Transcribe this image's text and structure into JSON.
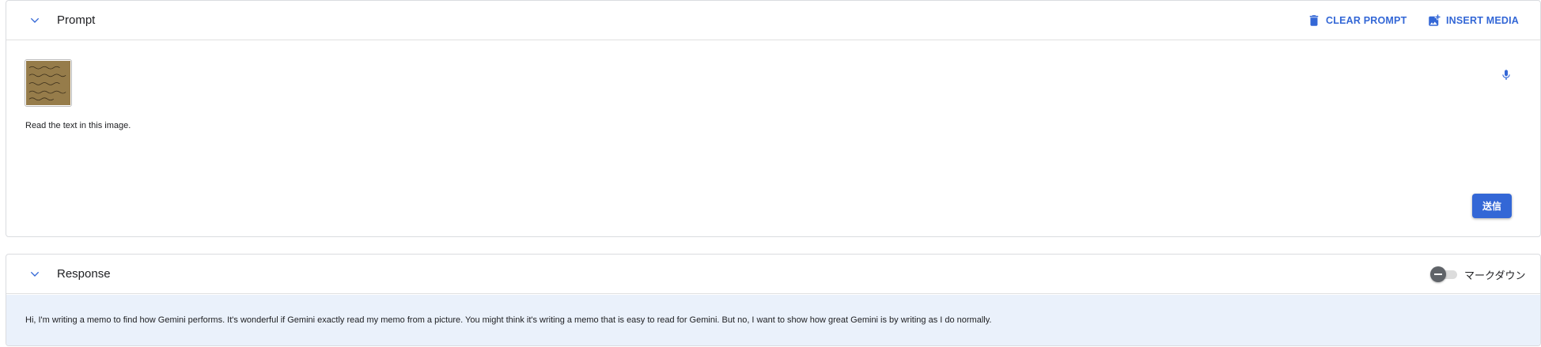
{
  "prompt": {
    "title": "Prompt",
    "clear_label": "CLEAR PROMPT",
    "insert_label": "INSERT MEDIA",
    "text": "Read the text in this image.",
    "send_label": "送信"
  },
  "response": {
    "title": "Response",
    "markdown_label": "マークダウン",
    "markdown_enabled": false,
    "text": "Hi, I'm writing a memo to find how Gemini performs. It's wonderful if Gemini exactly read my memo from a picture. You might think it's writing a memo that is easy to read for Gemini. But no, I want to show how great Gemini is by writing as I do normally."
  },
  "icons": {
    "collapse": "chevron-down-icon",
    "clear": "trash-icon",
    "insert": "add-photo-icon",
    "mic": "mic-icon",
    "toggle_knob": "minus-icon"
  },
  "colors": {
    "accent": "#3367d6",
    "response_bg": "#eaf1fb",
    "border": "#dadce0"
  }
}
